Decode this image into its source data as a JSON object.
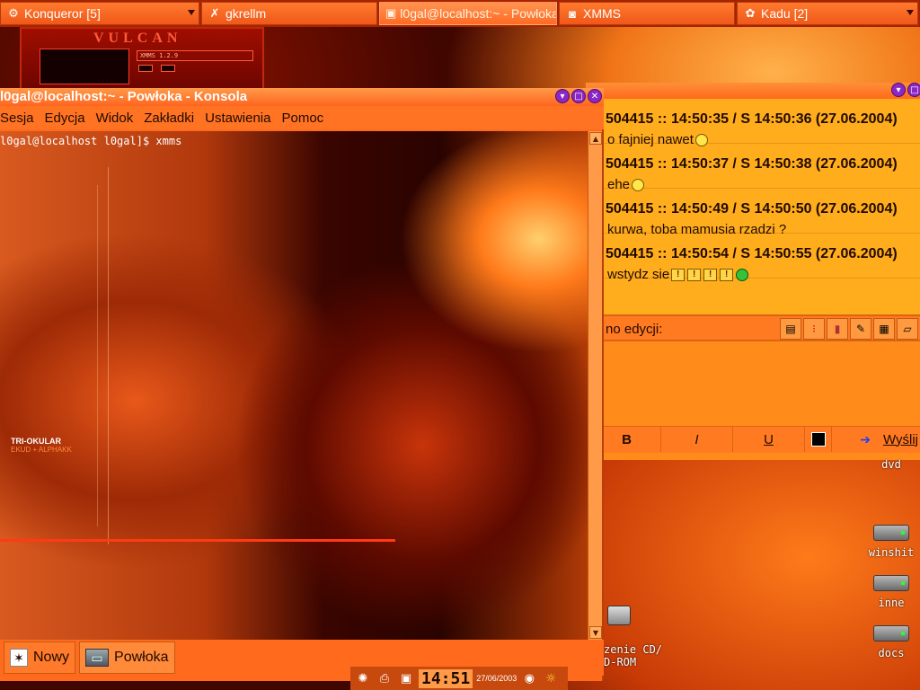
{
  "taskbar": {
    "tasks": [
      {
        "label": "Konqueror [5]",
        "icon": "konqueror-icon"
      },
      {
        "label": "gkrellm",
        "icon": "gkrellm-icon"
      },
      {
        "label": "l0gal@localhost:~ - Powłoka",
        "icon": "terminal-icon"
      },
      {
        "label": "XMMS",
        "icon": "xmms-icon"
      },
      {
        "label": "Kadu [2]",
        "icon": "kadu-icon"
      }
    ]
  },
  "xmms": {
    "logo": "VULCAN",
    "version": "XMMS 1.2.9"
  },
  "konsole": {
    "title": "l0gal@localhost:~ - Powłoka - Konsola",
    "menu": [
      "Sesja",
      "Edycja",
      "Widok",
      "Zakładki",
      "Ustawienia",
      "Pomoc"
    ],
    "prompt": "l0gal@localhost l0gal]$ xmms",
    "tabs": [
      {
        "label": "Nowy",
        "icon": "new-session-icon"
      },
      {
        "label": "Powłoka",
        "icon": "terminal-icon"
      }
    ],
    "wallpaper_text": [
      "TRI-OKULAR",
      "EKUD + ALPHAKK"
    ]
  },
  "kadu": {
    "messages": [
      {
        "head": "504415 :: 14:50:35 / S 14:50:36 (27.06.2004)",
        "body": "o fajniej nawet",
        "emoticons": [
          "smile"
        ]
      },
      {
        "head": "504415 :: 14:50:37 / S 14:50:38 (27.06.2004)",
        "body": "ehe",
        "emoticons": [
          "smile"
        ]
      },
      {
        "head": "504415 :: 14:50:49 / S 14:50:50 (27.06.2004)",
        "body": "kurwa, toba mamusia rzadzi ?",
        "emoticons": []
      },
      {
        "head": "504415 :: 14:50:54 / S 14:50:55 (27.06.2004)",
        "body": "wstydz sie",
        "emoticons": [
          "excl",
          "excl",
          "excl",
          "excl",
          "green"
        ]
      }
    ],
    "edit_label": "no edycji:",
    "format": {
      "bold": "B",
      "italic": "I",
      "underline": "U",
      "send": "Wyślij"
    }
  },
  "desktop": {
    "icons": [
      {
        "label": "dvd"
      },
      {
        "label": "winshit"
      },
      {
        "label": "inne"
      },
      {
        "label": "docs"
      }
    ],
    "cdrom_label": "zenie CD/\nD-ROM"
  },
  "tray": {
    "clock": "14:51",
    "date": "27/06/2003"
  },
  "colors": {
    "accent": "#ff6a1c",
    "chat_bg": "#ffad1c",
    "titlebar": "#ff8f38"
  }
}
